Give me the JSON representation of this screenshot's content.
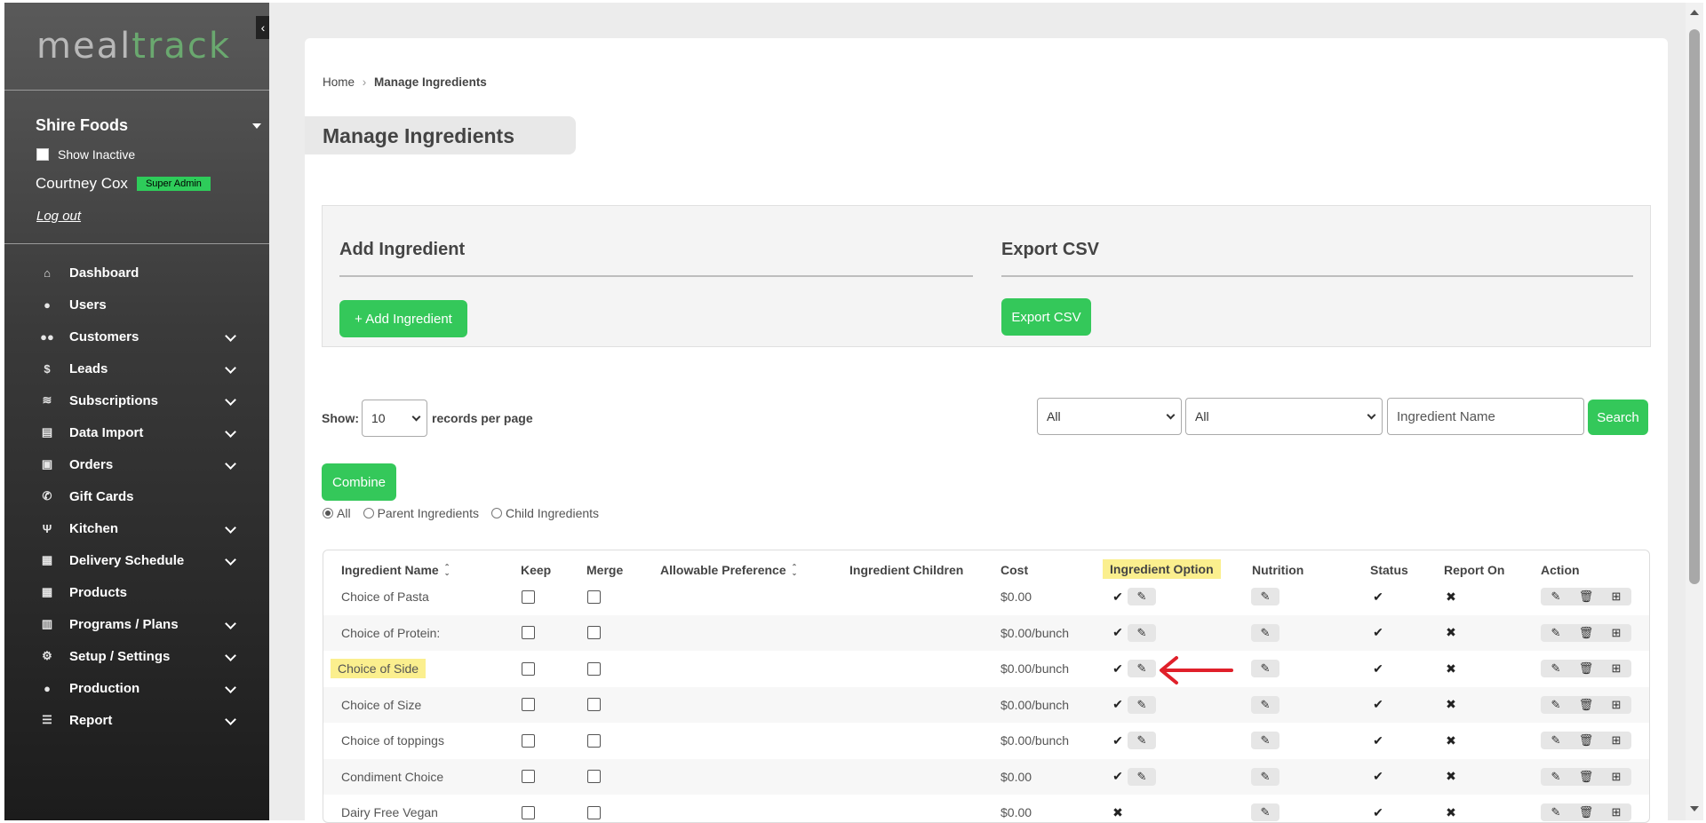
{
  "sidebar": {
    "logo_meal": "meal",
    "logo_track": "track",
    "company": "Shire Foods",
    "show_inactive": "Show Inactive",
    "user_name": "Courtney Cox",
    "role": "Super Admin",
    "logout": "Log out",
    "nav": [
      {
        "label": "Dashboard",
        "icon": "home-icon",
        "glyph": "⌂",
        "has_children": false
      },
      {
        "label": "Users",
        "icon": "user-icon",
        "glyph": "●",
        "has_children": false
      },
      {
        "label": "Customers",
        "icon": "users-icon",
        "glyph": "●●",
        "has_children": true
      },
      {
        "label": "Leads",
        "icon": "dollar-circle-icon",
        "glyph": "$",
        "has_children": true
      },
      {
        "label": "Subscriptions",
        "icon": "layers-icon",
        "glyph": "≋",
        "has_children": true
      },
      {
        "label": "Data Import",
        "icon": "file-import-icon",
        "glyph": "▤",
        "has_children": true
      },
      {
        "label": "Orders",
        "icon": "shopping-bag-icon",
        "glyph": "▣",
        "has_children": true
      },
      {
        "label": "Gift Cards",
        "icon": "phone-icon",
        "glyph": "✆",
        "has_children": false
      },
      {
        "label": "Kitchen",
        "icon": "utensils-icon",
        "glyph": "Ψ",
        "has_children": true
      },
      {
        "label": "Delivery Schedule",
        "icon": "calendar-icon",
        "glyph": "▦",
        "has_children": true
      },
      {
        "label": "Products",
        "icon": "calendar-icon",
        "glyph": "▦",
        "has_children": false
      },
      {
        "label": "Programs / Plans",
        "icon": "clipboard-icon",
        "glyph": "▥",
        "has_children": true
      },
      {
        "label": "Setup / Settings",
        "icon": "gear-icon",
        "glyph": "⚙",
        "has_children": true
      },
      {
        "label": "Production",
        "icon": "user-icon",
        "glyph": "●",
        "has_children": true
      },
      {
        "label": "Report",
        "icon": "list-check-icon",
        "glyph": "☰",
        "has_children": true
      }
    ]
  },
  "breadcrumb": {
    "home": "Home",
    "separator": "›",
    "current": "Manage Ingredients"
  },
  "page_title": "Manage Ingredients",
  "add_panel": {
    "heading": "Add Ingredient",
    "button": "+ Add Ingredient"
  },
  "export_panel": {
    "heading": "Export CSV",
    "button": "Export CSV"
  },
  "show": {
    "prefix": "Show:",
    "value": "10",
    "suffix": "records per page"
  },
  "filters": {
    "filter1": "All",
    "filter2": "All",
    "search_placeholder": "Ingredient Name",
    "search_button": "Search"
  },
  "combine_button": "Combine",
  "radio_options": [
    {
      "label": "All",
      "checked": true
    },
    {
      "label": "Parent Ingredients",
      "checked": false
    },
    {
      "label": "Child Ingredients",
      "checked": false
    }
  ],
  "table": {
    "headers": {
      "name": "Ingredient Name",
      "keep": "Keep",
      "merge": "Merge",
      "allowable": "Allowable Preference",
      "children": "Ingredient Children",
      "cost": "Cost",
      "option": "Ingredient Option",
      "nutrition": "Nutrition",
      "status": "Status",
      "report_on": "Report On",
      "action": "Action"
    },
    "rows": [
      {
        "name": "Choice of Pasta",
        "cost": "$0.00",
        "option": "✔",
        "option_editable": true,
        "status": "✔",
        "report_on": "✖",
        "highlighted": false
      },
      {
        "name": "Choice of Protein:",
        "cost": "$0.00/bunch",
        "option": "✔",
        "option_editable": true,
        "status": "✔",
        "report_on": "✖",
        "highlighted": false
      },
      {
        "name": "Choice of Side",
        "cost": "$0.00/bunch",
        "option": "✔",
        "option_editable": true,
        "status": "✔",
        "report_on": "✖",
        "highlighted": true
      },
      {
        "name": "Choice of Size",
        "cost": "$0.00/bunch",
        "option": "✔",
        "option_editable": true,
        "status": "✔",
        "report_on": "✖",
        "highlighted": false
      },
      {
        "name": "Choice of toppings",
        "cost": "$0.00/bunch",
        "option": "✔",
        "option_editable": true,
        "status": "✔",
        "report_on": "✖",
        "highlighted": false
      },
      {
        "name": "Condiment Choice",
        "cost": "$0.00",
        "option": "✔",
        "option_editable": true,
        "status": "✔",
        "report_on": "✖",
        "highlighted": false
      },
      {
        "name": "Dairy Free Vegan",
        "cost": "$0.00",
        "option": "✖",
        "option_editable": false,
        "status": "✔",
        "report_on": "✖",
        "highlighted": false
      }
    ]
  },
  "icons": {
    "edit": "✎",
    "delete": "🗑",
    "hierarchy": "⊞"
  },
  "colors": {
    "accent_green": "#34c85a",
    "highlight_yellow": "#fbef8e",
    "arrow_red": "#e0202a",
    "role_badge": "#2ecc5a"
  }
}
